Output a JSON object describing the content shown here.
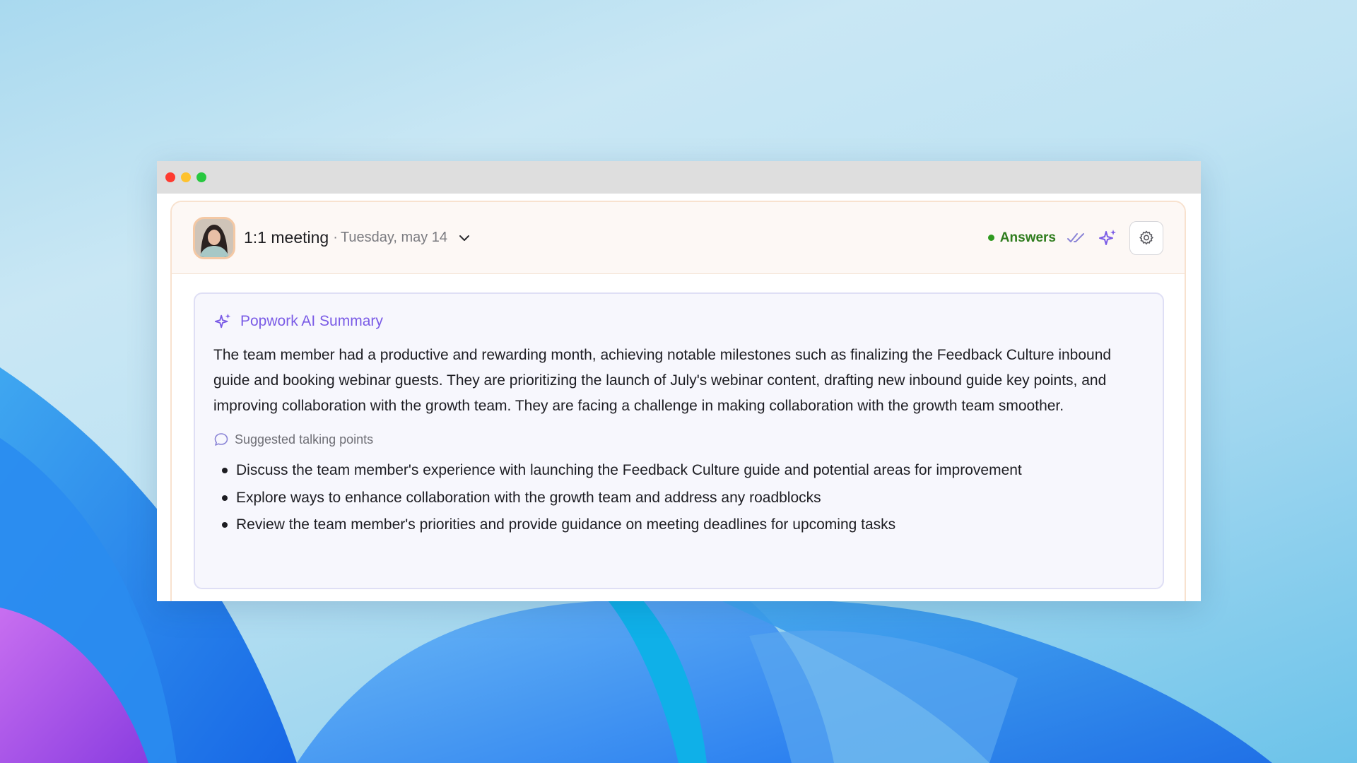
{
  "window": {
    "controls": [
      "close",
      "minimize",
      "maximize"
    ]
  },
  "header": {
    "title": "1:1 meeting",
    "separator": "·",
    "date": "Tuesday, may 14",
    "status_label": "Answers",
    "status_color": "#2f9a20"
  },
  "summary": {
    "title": "Popwork AI Summary",
    "accent_color": "#7a5be6",
    "text": "The team member had a productive and rewarding month, achieving notable milestones such as finalizing the Feedback Culture inbound guide and booking webinar guests. They are prioritizing the launch of July's webinar content, drafting new inbound guide key points, and improving collaboration with the growth team. They are facing a challenge in making collaboration with the growth team smoother.",
    "talking_points_label": "Suggested talking points",
    "talking_points": [
      "Discuss the team member's experience with launching the Feedback Culture guide and potential areas for improvement",
      "Explore ways to enhance collaboration with the growth team and address any roadblocks",
      "Review the team member's priorities and provide guidance on meeting deadlines for upcoming tasks"
    ]
  },
  "icons": {
    "chevron": "chevron-down-icon",
    "read": "double-check-icon",
    "ai": "sparkles-icon",
    "settings": "gear-icon",
    "talk": "speech-bubble-icon"
  }
}
